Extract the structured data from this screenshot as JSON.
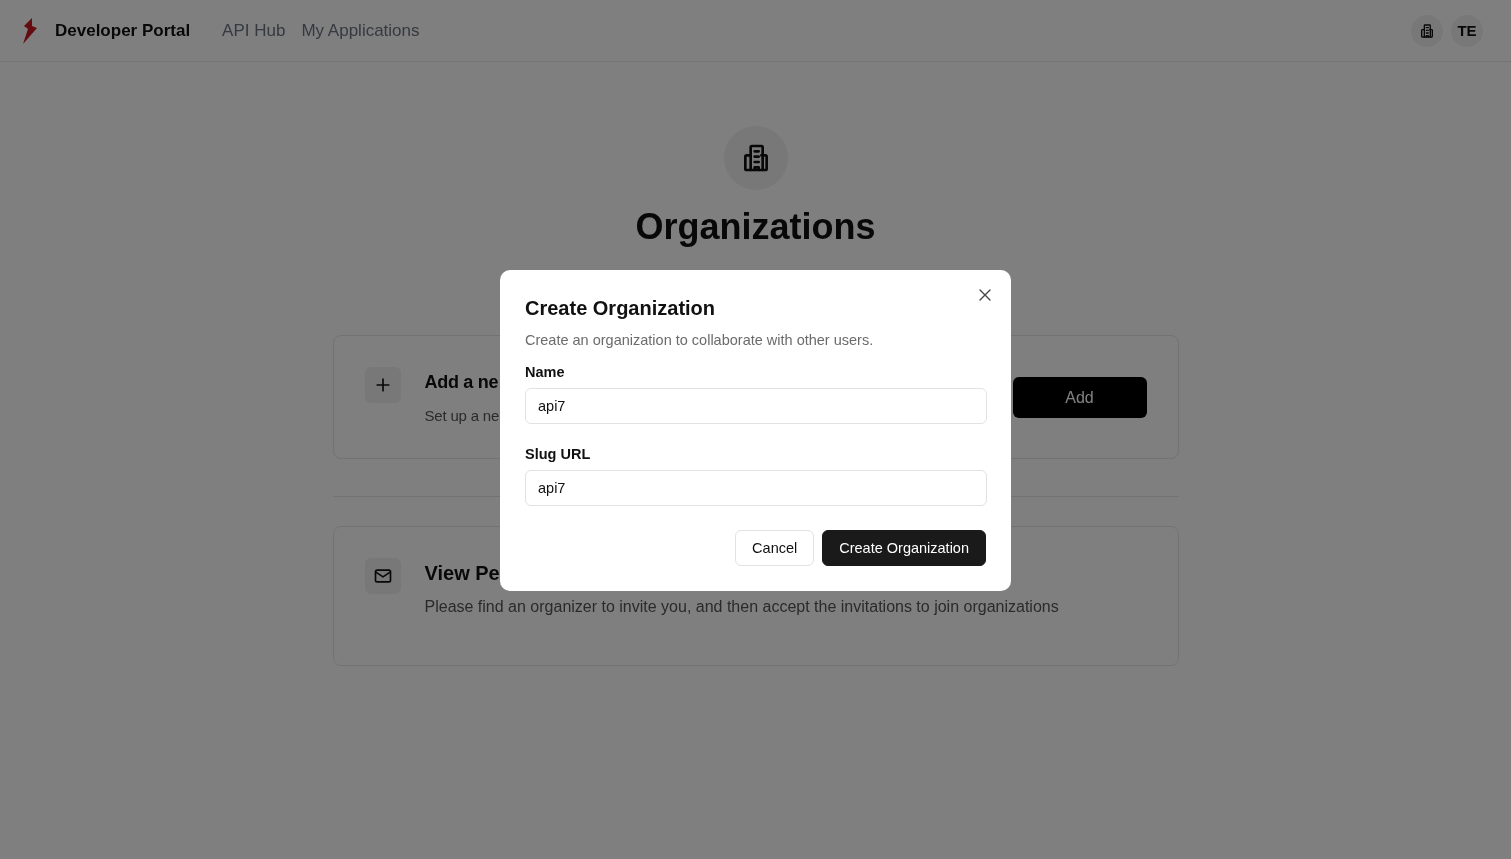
{
  "header": {
    "brand": "Developer Portal",
    "nav": [
      {
        "label": "API Hub"
      },
      {
        "label": "My Applications"
      }
    ],
    "avatar": "TE"
  },
  "page": {
    "title": "Organizations",
    "cards": [
      {
        "kind": "add",
        "title": "Add a ne",
        "description": "Set up a ne",
        "button": "Add"
      },
      {
        "kind": "invitations",
        "title": "View Pe",
        "description": "Please find an organizer to invite you, and then accept the invitations to join organizations"
      }
    ]
  },
  "dialog": {
    "title": "Create Organization",
    "description": "Create an organization to collaborate with other users.",
    "fields": [
      {
        "label": "Name",
        "value": "api7"
      },
      {
        "label": "Slug URL",
        "value": "api7"
      }
    ],
    "buttons": [
      {
        "label": "Cancel",
        "kind": "secondary"
      },
      {
        "label": "Create Organization",
        "kind": "primary"
      }
    ]
  }
}
